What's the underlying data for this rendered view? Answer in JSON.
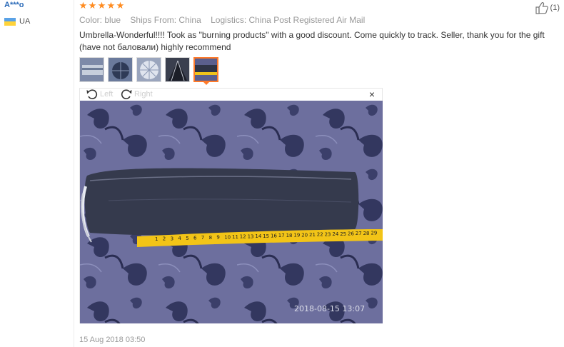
{
  "user": {
    "name": "A***o",
    "country": "UA"
  },
  "rating": {
    "stars": 5,
    "star_glyph": "★"
  },
  "helpful": {
    "count": "(1)",
    "icon": "thumbs-up-icon"
  },
  "meta": {
    "color_label": "Color:",
    "color_value": "blue",
    "ships_label": "Ships From:",
    "ships_value": "China",
    "logistics_label": "Logistics:",
    "logistics_value": "China Post Registered Air Mail"
  },
  "review": {
    "text": "Umbrella-Wonderful!!!! Took as \"burning products\" with a good discount. Come quickly to track. Seller, thank you for the gift (have not баловали) highly recommend"
  },
  "thumbnails": [
    "photo-1",
    "photo-2",
    "photo-3",
    "photo-4",
    "photo-5"
  ],
  "viewer": {
    "rotate_left": "Left",
    "rotate_right": "Right",
    "close_glyph": "×",
    "photo_timestamp": "2018-08-15 13:07"
  },
  "ruler": {
    "numbers": [
      "1",
      "2",
      "3",
      "4",
      "5",
      "6",
      "7",
      "8",
      "9",
      "10",
      "11",
      "12",
      "13",
      "14",
      "15",
      "16",
      "17",
      "18",
      "19",
      "20",
      "21",
      "22",
      "23",
      "24",
      "25",
      "26",
      "27",
      "28",
      "29"
    ]
  },
  "date": "15 Aug 2018 03:50",
  "colors": {
    "accent": "#ff7a2a",
    "star": "#ff8b1f",
    "link": "#2a6ab8",
    "carpet": "#5b5f8e"
  }
}
